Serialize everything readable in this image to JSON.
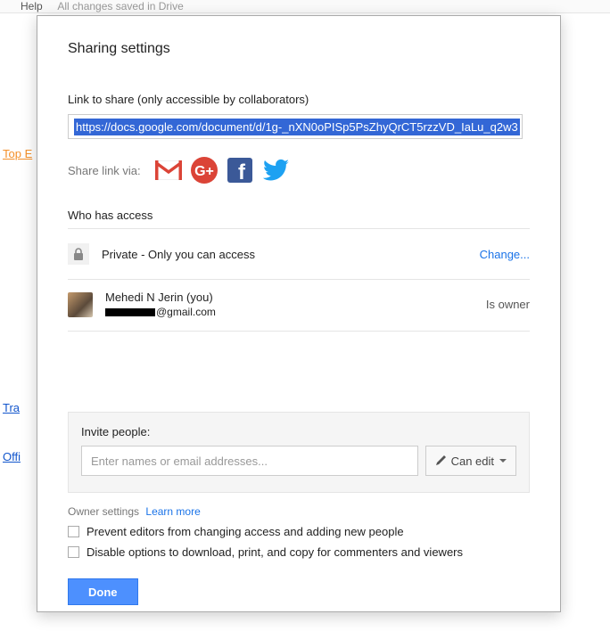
{
  "bg": {
    "help": "Help",
    "saved": "All changes saved in Drive",
    "top": "Top E",
    "tra": "Tra",
    "off": "Offi"
  },
  "dialog": {
    "title": "Sharing settings",
    "link_label": "Link to share (only accessible by collaborators)",
    "link_url": "https://docs.google.com/document/d/1g-_nXN0oPISp5PsZhyQrCT5rzzVD_IaLu_q2w3",
    "share_via": "Share link via:",
    "who_header": "Who has access",
    "access": {
      "privacy": "Private - Only you can access",
      "change": "Change..."
    },
    "person": {
      "name": "Mehedi N Jerin (you)",
      "email_suffix": "@gmail.com",
      "role": "Is owner"
    },
    "invite": {
      "label": "Invite people:",
      "placeholder": "Enter names or email addresses...",
      "perm": "Can edit"
    },
    "owner_settings": {
      "label": "Owner settings",
      "learn_more": "Learn more",
      "opt1": "Prevent editors from changing access and adding new people",
      "opt2": "Disable options to download, print, and copy for commenters and viewers"
    },
    "done": "Done"
  }
}
